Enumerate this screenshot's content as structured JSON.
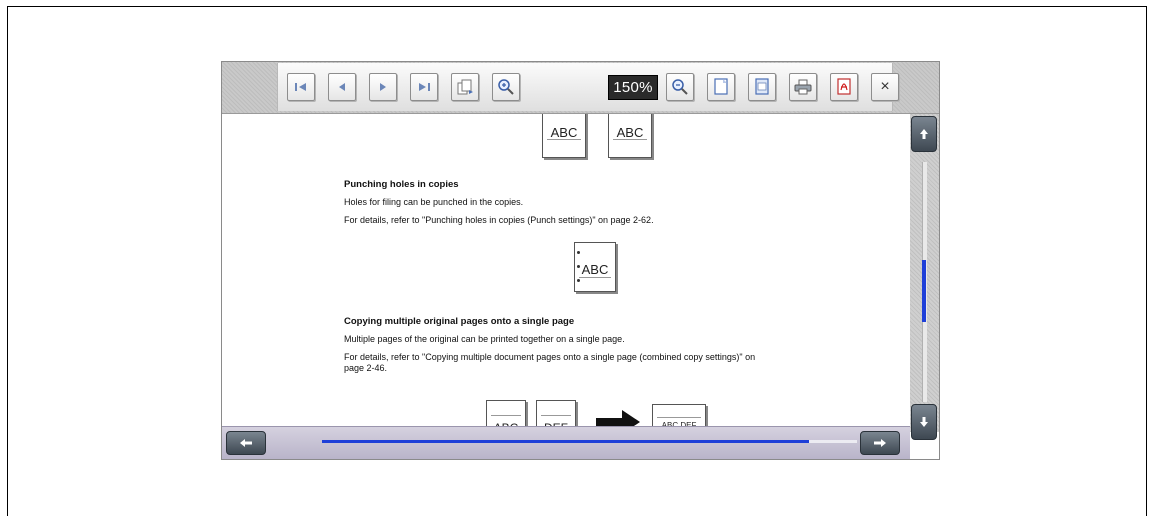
{
  "toolbar": {
    "buttons": [
      {
        "name": "first-page-icon"
      },
      {
        "name": "previous-page-icon"
      },
      {
        "name": "next-page-icon"
      },
      {
        "name": "last-page-icon"
      },
      {
        "name": "rotate-page-icon"
      },
      {
        "name": "zoom-in-icon"
      },
      {
        "name": "zoom-out-icon"
      },
      {
        "name": "fit-page-icon"
      },
      {
        "name": "fit-width-icon"
      },
      {
        "name": "print-icon"
      },
      {
        "name": "pdf-icon"
      },
      {
        "name": "close-icon"
      }
    ],
    "zoom_level": "150%",
    "close_glyph": "×"
  },
  "document": {
    "top_icons": [
      "ABC",
      "ABC"
    ],
    "section1": {
      "heading": "Punching holes in copies",
      "line1": "Holes for filing can be punched in the copies.",
      "line2": "For details, refer to \"Punching holes in copies (Punch settings)\" on page 2-62.",
      "icon_label": "ABC"
    },
    "section2": {
      "heading": "Copying multiple original pages onto a single page",
      "line1": "Multiple pages of the original can be printed together on a single page.",
      "line2a": "For details, refer to \"Copying multiple document pages onto a single page (combined copy settings)\" on",
      "line2b": "page 2-46.",
      "icon_labels": [
        "ABC",
        "DEF",
        "ABC DEF"
      ]
    }
  },
  "scroll": {
    "vertical_position": 0.55,
    "horizontal_position": 0.01,
    "horizontal_visible_fraction": 0.91
  },
  "colors": {
    "scroll_thumb": "#1e3fd8",
    "toolbar_bg": "#c9c9c9",
    "scroll_button": "#4a545e"
  }
}
